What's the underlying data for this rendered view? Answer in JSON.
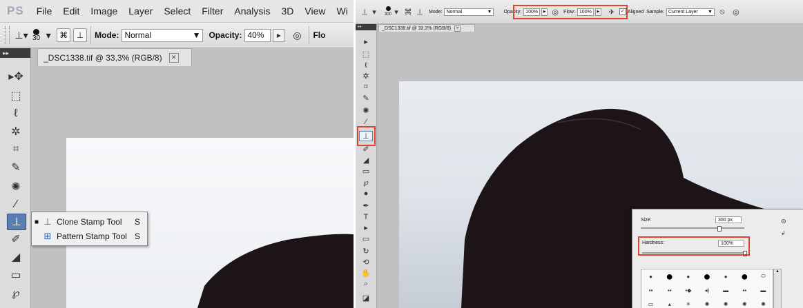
{
  "left": {
    "menu": {
      "logo": "PS",
      "items": [
        "File",
        "Edit",
        "Image",
        "Layer",
        "Select",
        "Filter",
        "Analysis",
        "3D",
        "View",
        "Wi"
      ]
    },
    "options": {
      "brush_size": "30",
      "mode_label": "Mode:",
      "mode_value": "Normal",
      "opacity_label": "Opacity:",
      "opacity_value": "40%",
      "flow_label": "Flo"
    },
    "document_tab": "_DSC1338.tif @ 33,3% (RGB/8)",
    "flyout": [
      {
        "label": "Clone Stamp Tool",
        "key": "S",
        "selected": true
      },
      {
        "label": "Pattern Stamp Tool",
        "key": "S",
        "selected": false
      }
    ]
  },
  "right": {
    "options": {
      "brush_size": "300",
      "mode_label": "Mode:",
      "mode_value": "Normal",
      "opacity_label": "Opacity:",
      "opacity_value": "100%",
      "flow_label": "Flow:",
      "flow_value": "100%",
      "aligned_label": "Aligned",
      "sample_label": "Sample:",
      "sample_value": "Current Layer"
    },
    "document_tab": "_DSC1338.tif @ 33,3% (RGB/8)",
    "brush_picker": {
      "size_label": "Size:",
      "size_value": "300 px",
      "hardness_label": "Hardness:",
      "hardness_value": "100%"
    }
  },
  "colors": {
    "highlight": "#e0432c",
    "active_tool": "#5a7fb0",
    "hat": "#1c1416"
  }
}
